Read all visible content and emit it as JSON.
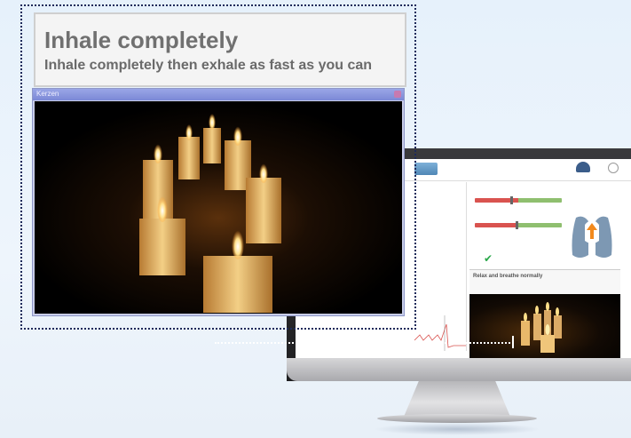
{
  "instruction": {
    "title": "Inhale completely",
    "subtitle": "Inhale completely then exhale as fast as you can"
  },
  "video_window": {
    "title": "Kerzen"
  },
  "screen_app": {
    "relax_title": "Relax and breathe normally"
  },
  "colors": {
    "background": "#e6f1fb",
    "overlay_border": "#1d2a5a",
    "candle_flame": "#ffcc55",
    "lung_arrow": "#f28a1e",
    "check": "#2aa84a"
  }
}
